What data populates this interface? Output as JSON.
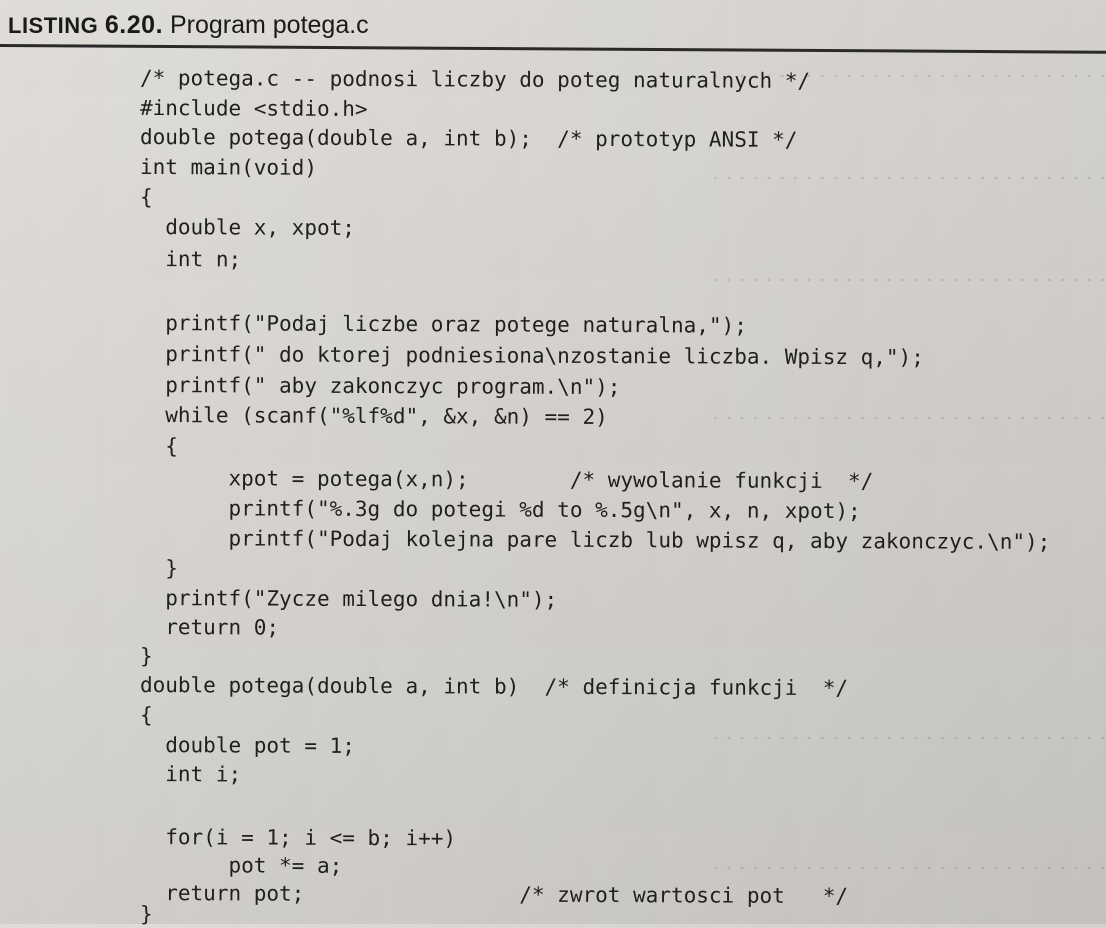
{
  "listing": {
    "label": "LISTING",
    "number": "6.20.",
    "title": "Program potega.c"
  },
  "code_lines": [
    "/* potega.c -- podnosi liczby do poteg naturalnych */",
    "#include <stdio.h>",
    "double potega(double a, int b);  /* prototyp ANSI */",
    "int main(void)",
    "{",
    "  double x, xpot;",
    "  int n;",
    "",
    "  printf(\"Podaj liczbe oraz potege naturalna,\");",
    "  printf(\" do ktorej podniesiona\\nzostanie liczba. Wpisz q,\");",
    "  printf(\" aby zakonczyc program.\\n\");",
    "  while (scanf(\"%lf%d\", &x, &n) == 2)",
    "  {",
    "       xpot = potega(x,n);        /* wywolanie funkcji  */",
    "       printf(\"%.3g do potegi %d to %.5g\\n\", x, n, xpot);",
    "       printf(\"Podaj kolejna pare liczb lub wpisz q, aby zakonczyc.\\n\");",
    "  }",
    "  printf(\"Zycze milego dnia!\\n\");",
    "  return 0;",
    "}",
    "double potega(double a, int b)  /* definicja funkcji  */",
    "{",
    "  double pot = 1;",
    "  int i;",
    "",
    "  for(i = 1; i <= b; i++)",
    "       pot *= a;",
    "  return pot;                 /* zwrot wartosci pot   */",
    "}"
  ]
}
